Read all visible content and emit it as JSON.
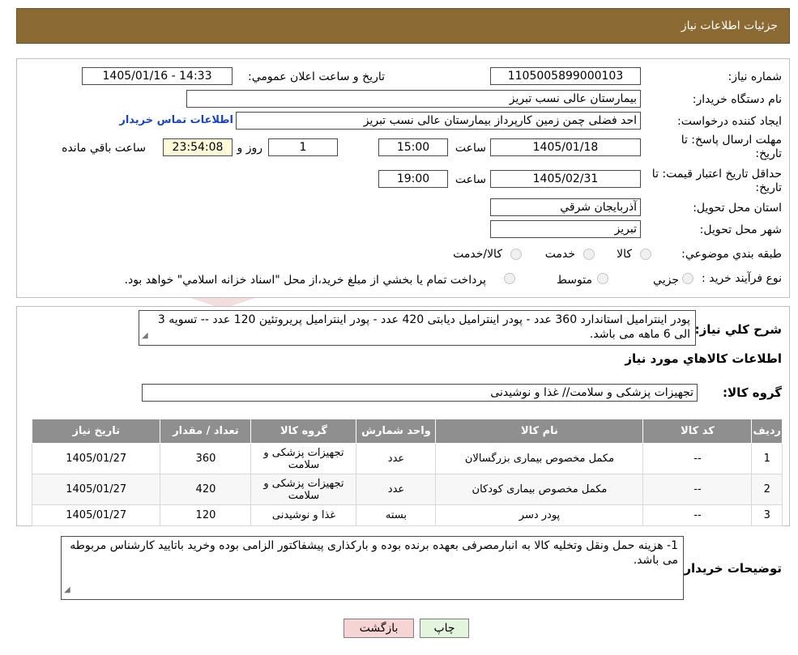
{
  "header": {
    "title": "جزئیات اطلاعات نیاز"
  },
  "form": {
    "need_number_label": "شماره نیاز:",
    "need_number": "1105005899000103",
    "announce_label": "تاریخ و ساعت اعلان عمومي:",
    "announce_value": "1405/01/16 - 14:33",
    "buyer_label": "نام دستگاه خريدار:",
    "buyer_value": "بیمارستان عالی نسب تبریز",
    "creator_label": "ايجاد کننده درخواست:",
    "creator_value": "احد فضلی چمن زمین کارپرداز  بیمارستان عالی نسب تبریز",
    "contact_link": "اطلاعات تماس خريدار",
    "reply_deadline_label_1": "مهلت ارسال پاسخ: تا",
    "reply_deadline_label_2": "تاريخ:",
    "reply_date": "1405/01/18",
    "time_label": "ساعت",
    "reply_time": "15:00",
    "days_value": "1",
    "days_label": "روز و",
    "remaining_time": "23:54:08",
    "remaining_label": "ساعت باقي مانده",
    "price_validity_label_1": "حداقل تاريخ اعتبار قيمت: تا",
    "price_validity_label_2": "تاريخ:",
    "price_date": "1405/02/31",
    "price_time": "19:00",
    "province_label": "استان محل تحويل:",
    "province_value": "آذربايجان شرقي",
    "city_label": "شهر محل تحويل:",
    "city_value": "تبریز",
    "category_label": "طبقه بندي موضوعي:",
    "category_options": [
      "کالا",
      "خدمت",
      "کالا/خدمت"
    ],
    "process_label": "نوع فرآيند خريد :",
    "process_options": [
      "جزيي",
      "متوسط"
    ],
    "process_note": "پرداخت تمام يا بخشي از مبلغ خريد،از محل \"اسناد خزانه اسلامي\" خواهد بود."
  },
  "description": {
    "label": "شرح کلي نياز:",
    "text": "پودر اینترامیل استاندارد 360 عدد - پودر اینترامیل دیابتی 420 عدد - پودر اینترامیل پریروتئین 120 عدد -- تسویه 3 الی 6 ماهه می باشد."
  },
  "goods": {
    "section_title": "اطلاعات کالاهاي مورد نياز",
    "group_label": "گروه کالا:",
    "group_value": "تجهیزات پزشکی و سلامت// غذا و نوشیدنی",
    "columns": [
      "رديف",
      "کد کالا",
      "نام کالا",
      "واحد شمارش",
      "گروه کالا",
      "تعداد / مقدار",
      "تاريخ نياز"
    ],
    "rows": [
      {
        "row": "1",
        "code": "--",
        "name": "مکمل مخصوص بیماری بزرگسالان",
        "unit": "عدد",
        "group": "تجهیزات پزشکی و سلامت",
        "qty": "360",
        "date": "1405/01/27"
      },
      {
        "row": "2",
        "code": "--",
        "name": "مکمل مخصوص بیماری کودکان",
        "unit": "عدد",
        "group": "تجهیزات پزشکی و سلامت",
        "qty": "420",
        "date": "1405/01/27"
      },
      {
        "row": "3",
        "code": "--",
        "name": "پودر دسر",
        "unit": "بسته",
        "group": "غذا و نوشیدنی",
        "qty": "120",
        "date": "1405/01/27"
      }
    ]
  },
  "buyer_notes": {
    "label": "توضيحات خريدار:",
    "text": "1- هزینه حمل ونقل وتخلیه کالا به انبارمصرفی بعهده برنده بوده و بارکذاری پیشفاکتور الزامی بوده وخرید باتایید کارشناس مربوطه می باشد."
  },
  "buttons": {
    "print": "چاپ",
    "back": "بازگشت"
  },
  "colors": {
    "header_bg": "#8c6a33",
    "table_header_bg": "#8f8f8f",
    "link": "#1a44c4",
    "back_btn": "#f7d4d4",
    "print_btn": "#e3f5dc"
  }
}
